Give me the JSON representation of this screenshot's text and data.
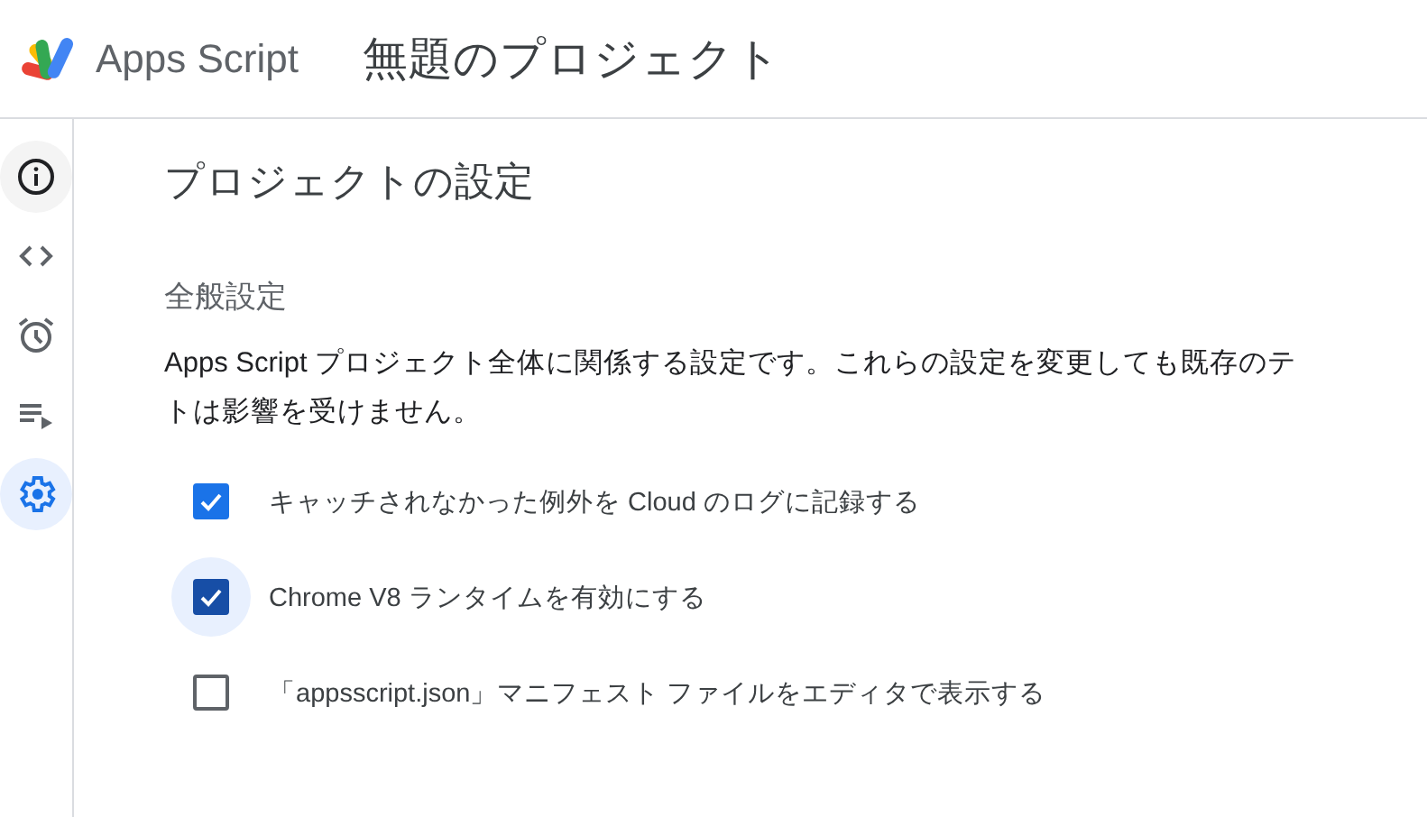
{
  "header": {
    "app_name": "Apps Script",
    "project_title": "無題のプロジェクト"
  },
  "sidebar": {
    "items": [
      {
        "kind": "info",
        "selected": false,
        "hovered": true
      },
      {
        "kind": "code",
        "selected": false,
        "hovered": false
      },
      {
        "kind": "alarm",
        "selected": false,
        "hovered": false
      },
      {
        "kind": "executions",
        "selected": false,
        "hovered": false
      },
      {
        "kind": "settings",
        "selected": true,
        "hovered": false
      }
    ]
  },
  "page_title": "プロジェクトの設定",
  "section": {
    "title": "全般設定",
    "description_lines": [
      "Apps Script プロジェクト全体に関係する設定です。これらの設定を変更しても既存のテ",
      "トは影響を受けません。"
    ],
    "options": [
      {
        "label": "キャッチされなかった例外を Cloud のログに記録する",
        "checked": true,
        "focused": false
      },
      {
        "label": "Chrome V8 ランタイムを有効にする",
        "checked": true,
        "focused": true
      },
      {
        "label": "「appsscript.json」マニフェスト ファイルをエディタで表示する",
        "checked": false,
        "focused": false
      }
    ]
  }
}
